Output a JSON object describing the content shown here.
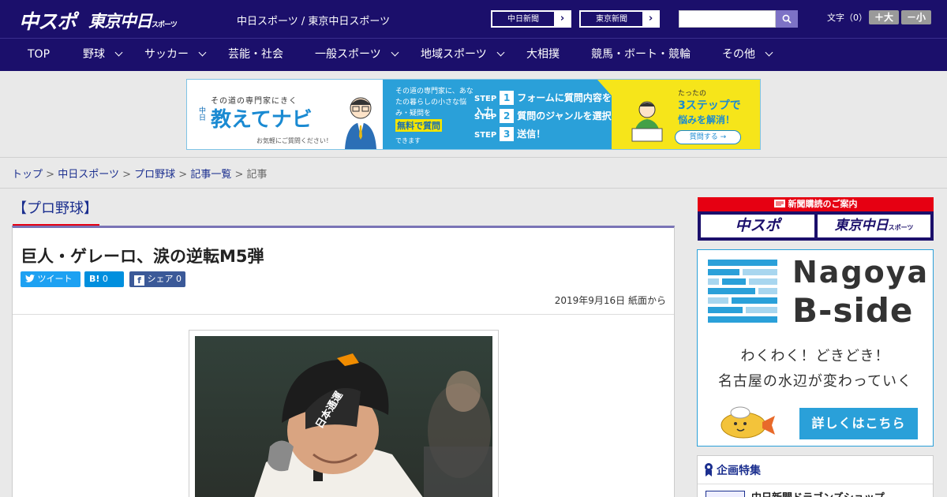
{
  "header": {
    "logo_chuspo": "中スポ",
    "logo_tokyo": "東京中日",
    "logo_tokyo_small": "スポーツ",
    "site_names": "中日スポーツ / 東京中日スポーツ",
    "paper_links": [
      {
        "label": "中日新聞",
        "arrow": "›"
      },
      {
        "label": "東京新聞",
        "arrow": "›"
      }
    ],
    "search": {
      "value": "",
      "placeholder": ""
    },
    "fontsize_label": "文字（0）",
    "bigger_label": "＋大",
    "smaller_label": "－小"
  },
  "nav": {
    "items": [
      {
        "label": "TOP",
        "has_menu": false
      },
      {
        "label": "野球",
        "has_menu": true
      },
      {
        "label": "サッカー",
        "has_menu": true
      },
      {
        "label": "芸能・社会",
        "has_menu": false
      },
      {
        "label": "一般スポーツ",
        "has_menu": true
      },
      {
        "label": "地域スポーツ",
        "has_menu": true
      },
      {
        "label": "大相撲",
        "has_menu": false
      },
      {
        "label": "競馬・ボート・競輪",
        "has_menu": false
      },
      {
        "label": "その他",
        "has_menu": true
      }
    ]
  },
  "ad": {
    "tagline": "その道の専門家にきく",
    "brand_prefix": "中日",
    "brand": "教えてナビ",
    "note": "お気軽にご質問ください！",
    "mid_text": "その道の専門家に、あなたの暮らしの小さな悩み・疑問を",
    "free_label": "無料で質問",
    "mid_small": "できます",
    "steps": [
      {
        "word": "STEP",
        "num": "1",
        "text": "フォームに質問内容を入力"
      },
      {
        "word": "STEP",
        "num": "2",
        "text": "質問のジャンルを選択"
      },
      {
        "word": "STEP",
        "num": "3",
        "text": "送信！"
      }
    ],
    "right_small": "たったの",
    "right_big": "3ステップで",
    "right_mid": "悩みを解消！",
    "right_button": "質問する →",
    "colors": {
      "blue": "#2aa0d9",
      "yellow": "#f6e51a"
    }
  },
  "breadcrumb": {
    "items": [
      "トップ",
      "中日スポーツ",
      "プロ野球",
      "記事一覧"
    ],
    "separator": ">",
    "current": "記事"
  },
  "article": {
    "category": "【プロ野球】",
    "title": "巨人・ゲレーロ、涙の逆転M5弾",
    "share": {
      "tweet": "ツイート",
      "hatena_label": "B!",
      "hatena_count": "0",
      "fb_label": "シェア",
      "fb_count": "0"
    },
    "date": "2019年9月16日 紙面から",
    "photo_helmet_text": "日本通運"
  },
  "sidebar": {
    "subscribe_title": "新聞購読のご案内",
    "subscribe_chuspo": "中スポ",
    "subscribe_tokyo": "東京中日",
    "subscribe_tokyo_small": "スポーツ",
    "nagoya": {
      "title1": "Nagoya",
      "title2": "B-side",
      "text1": "わくわく！どきどき！",
      "text2": "名古屋の水辺が変わっていく",
      "button": "詳しくはこちら"
    },
    "feature": {
      "heading": "企画特集",
      "item": "中日新聞ドラゴンズショップ"
    }
  },
  "colors": {
    "header_bg": "#1b0f6b",
    "accent_red": "#e60012",
    "link_blue": "#1b2f8f",
    "twitter": "#1da1f2",
    "hatena": "#008fde",
    "facebook": "#3b5998"
  }
}
